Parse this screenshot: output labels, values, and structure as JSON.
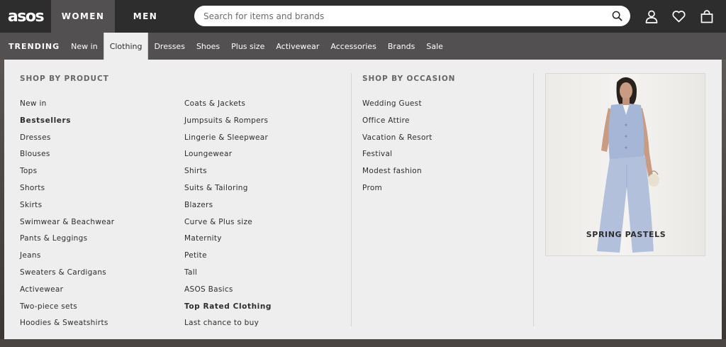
{
  "header": {
    "logo": "asos",
    "nav": {
      "women": "WOMEN",
      "men": "MEN"
    },
    "search": {
      "placeholder": "Search for items and brands"
    },
    "icons": [
      "search-icon",
      "account-icon",
      "heart-icon",
      "bag-icon"
    ]
  },
  "categories": [
    {
      "label": "TRENDING"
    },
    {
      "label": "New in"
    },
    {
      "label": "Clothing",
      "active": true
    },
    {
      "label": "Dresses"
    },
    {
      "label": "Shoes"
    },
    {
      "label": "Plus size"
    },
    {
      "label": "Activewear"
    },
    {
      "label": "Accessories"
    },
    {
      "label": "Brands"
    },
    {
      "label": "Sale"
    }
  ],
  "menu": {
    "shop_by_product": {
      "title": "SHOP BY PRODUCT",
      "col1": [
        "New in",
        "Bestsellers",
        "Dresses",
        "Blouses",
        "Tops",
        "Shorts",
        "Skirts",
        "Swimwear & Beachwear",
        "Pants & Leggings",
        "Jeans",
        "Sweaters & Cardigans",
        "Activewear",
        "Two-piece sets",
        "Hoodies & Sweatshirts"
      ],
      "col2": [
        "Coats & Jackets",
        "Jumpsuits & Rompers",
        "Lingerie & Sleepwear",
        "Loungewear",
        "Shirts",
        "Suits & Tailoring",
        "Blazers",
        "Curve & Plus size",
        "Maternity",
        "Petite",
        "Tall",
        "ASOS Basics",
        "Top Rated Clothing",
        "Last chance to buy"
      ]
    },
    "shop_by_occasion": {
      "title": "SHOP BY OCCASION",
      "items": [
        "Wedding Guest",
        "Office Attire",
        "Vacation & Resort",
        "Festival",
        "Modest fashion",
        "Prom"
      ]
    },
    "promo": {
      "caption": "SPRING PASTELS"
    }
  },
  "colors": {
    "topbar": "#2d2d2d",
    "catbar": "#525050",
    "panel": "#eeeeee",
    "text": "#2d2d2d"
  }
}
